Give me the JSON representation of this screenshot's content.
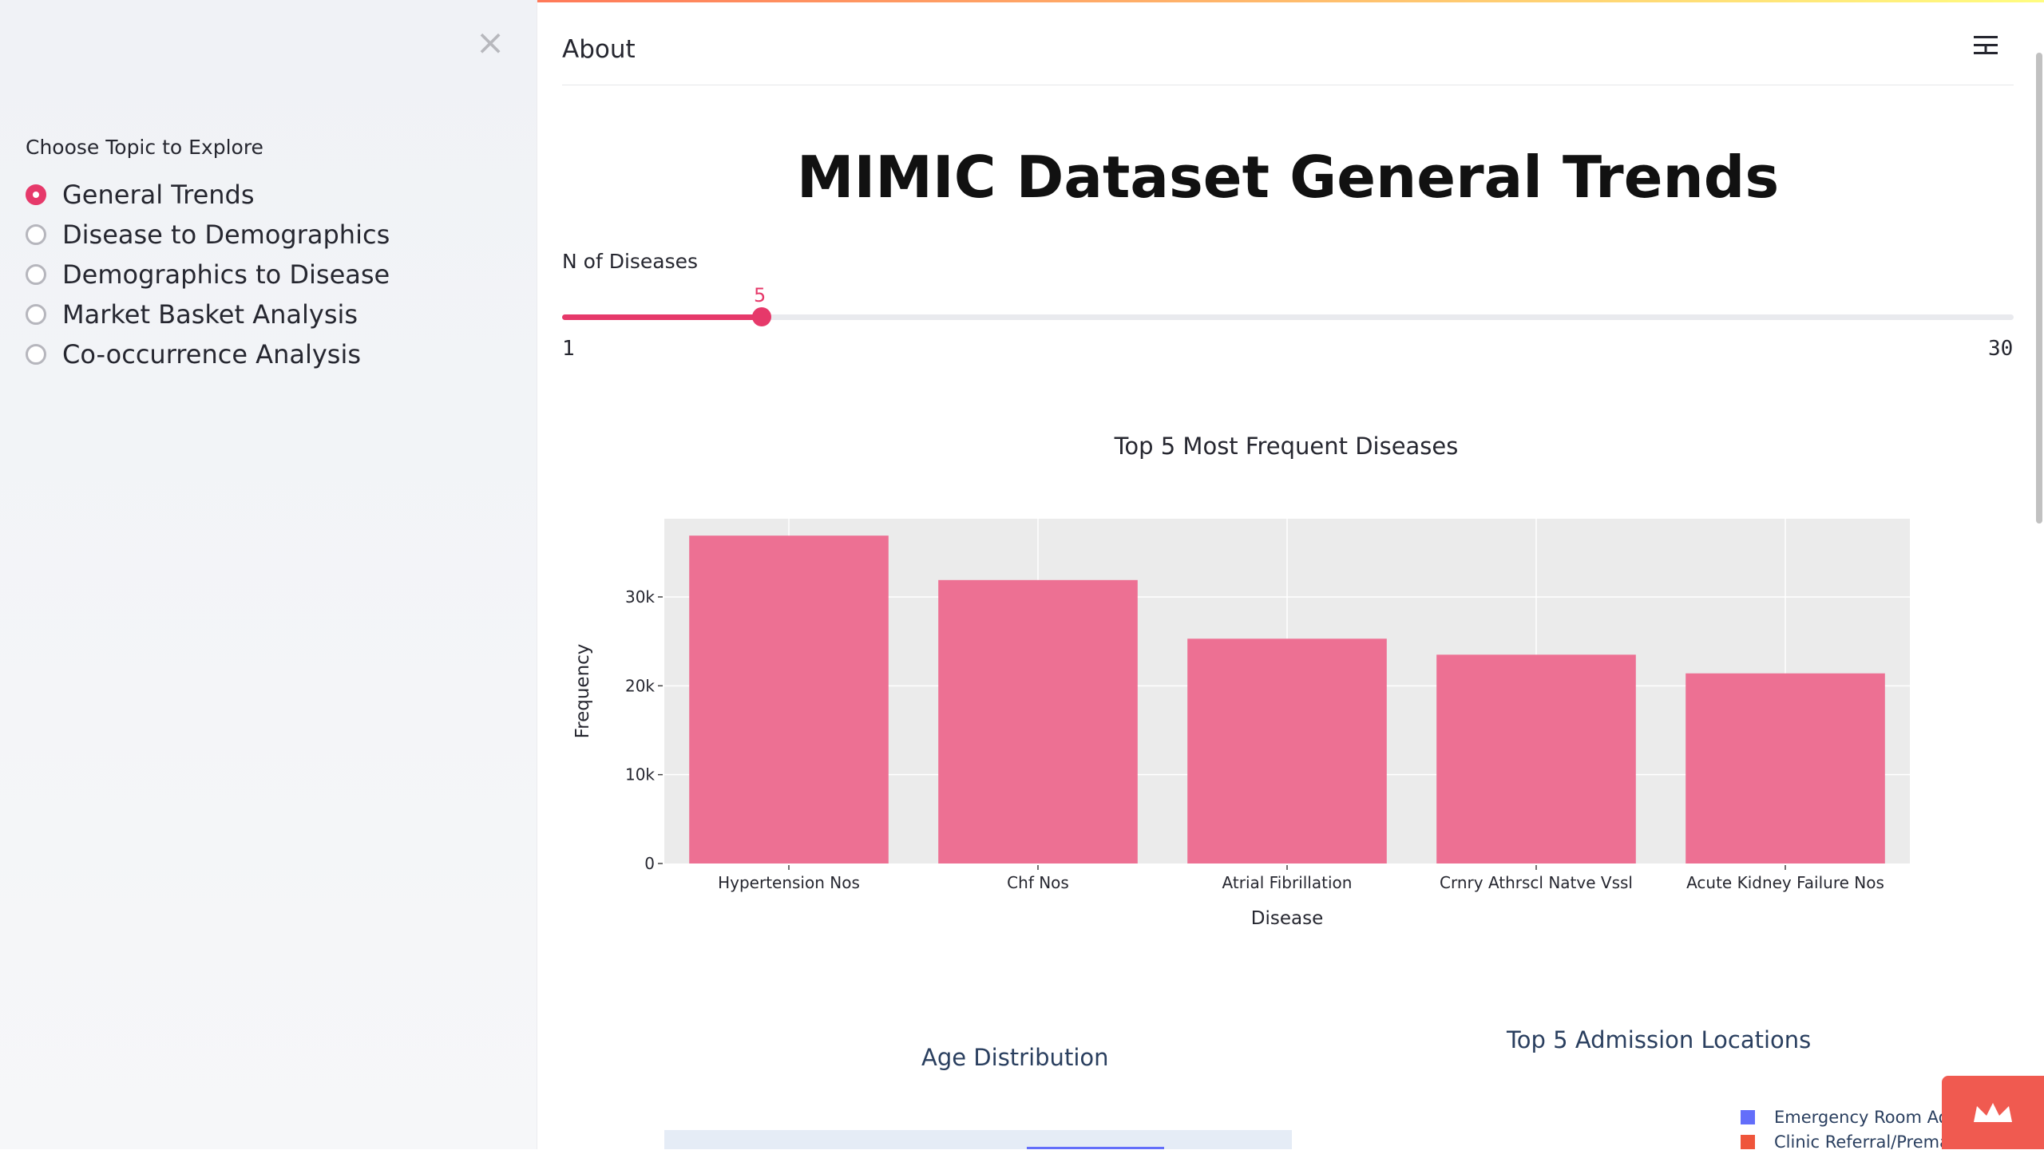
{
  "sidebar": {
    "label": "Choose Topic to Explore",
    "topics": [
      {
        "label": "General Trends",
        "selected": true
      },
      {
        "label": "Disease to Demographics",
        "selected": false
      },
      {
        "label": "Demographics to Disease",
        "selected": false
      },
      {
        "label": "Market Basket Analysis",
        "selected": false
      },
      {
        "label": "Co-occurrence Analysis",
        "selected": false
      }
    ],
    "close_icon": "close-icon"
  },
  "header": {
    "about_label": "About",
    "menu_icon": "hamburger-menu-icon"
  },
  "main": {
    "title": "MIMIC Dataset General Trends",
    "slider": {
      "label": "N of Diseases",
      "value": 5,
      "value_text": "5",
      "min": "1",
      "max": "30"
    }
  },
  "age_chart": {
    "title": "Age Distribution"
  },
  "admission_chart": {
    "title": "Top 5 Admission Locations",
    "legend": [
      {
        "label": "Emergency Room Adm",
        "color": "#636efa"
      },
      {
        "label": "Clinic Referral/Premat",
        "color": "#ef553b"
      }
    ]
  },
  "colors": {
    "accent": "#e6396a",
    "bar": "#ed7093",
    "plot_bg": "#ebebeb"
  },
  "chart_data": {
    "type": "bar",
    "title": "Top 5 Most Frequent Diseases",
    "xlabel": "Disease",
    "ylabel": "Frequency",
    "categories": [
      "Hypertension Nos",
      "Chf Nos",
      "Atrial Fibrillation",
      "Crnry Athrscl Natve Vssl",
      "Acute Kidney Failure Nos"
    ],
    "values": [
      36900,
      31900,
      25300,
      23500,
      21400
    ],
    "yticks": [
      0,
      10000,
      20000,
      30000
    ],
    "ytick_labels": [
      "0",
      "10k",
      "20k",
      "30k"
    ],
    "ylim": [
      0,
      38800
    ],
    "grid": true
  }
}
